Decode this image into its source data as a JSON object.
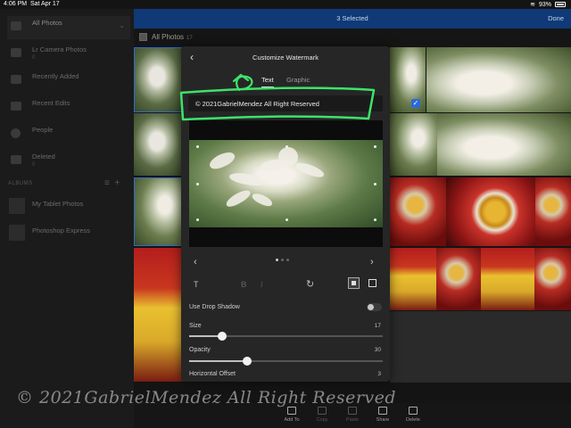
{
  "status": {
    "time": "4:06 PM",
    "date": "Sat Apr 17",
    "battery": "93%"
  },
  "sidebar": {
    "items": [
      {
        "label": "All Photos",
        "count": ""
      },
      {
        "label": "Lr Camera Photos",
        "count": "0"
      },
      {
        "label": "Recently Added",
        "count": ""
      },
      {
        "label": "Recent Edits",
        "count": ""
      },
      {
        "label": "People",
        "count": ""
      },
      {
        "label": "Deleted",
        "count": "0"
      }
    ],
    "albums_heading": "ALBUMS",
    "albums": [
      {
        "label": "My Tablet Photos",
        "count": ""
      },
      {
        "label": "Photoshop Express",
        "count": ""
      }
    ]
  },
  "selbar": {
    "title": "3 Selected",
    "done": "Done"
  },
  "grid": {
    "title": "All Photos",
    "count": "17"
  },
  "modal": {
    "title": "Customize Watermark",
    "tabs": [
      "Text",
      "Graphic"
    ],
    "active_tab": "Text",
    "watermark_text": "© 2021GabrielMendez All Right Reserved",
    "drop_shadow_label": "Use Drop Shadow",
    "drop_shadow_on": false,
    "sliders": [
      {
        "label": "Size",
        "value": "17",
        "fraction": 0.17
      },
      {
        "label": "Opacity",
        "value": "30",
        "fraction": 0.3
      }
    ],
    "horizontal_offset_label": "Horizontal Offset",
    "horizontal_offset_value": "3"
  },
  "overlay_watermark": "© 2021GabrielMendez All Right Reserved",
  "bottombar": {
    "buttons": [
      {
        "label": "Add To",
        "enabled": true
      },
      {
        "label": "Copy",
        "enabled": false
      },
      {
        "label": "Paste",
        "enabled": false
      },
      {
        "label": "Share",
        "enabled": true
      },
      {
        "label": "Delete",
        "enabled": true
      }
    ]
  },
  "colors": {
    "selection_bar": "#0f3a77",
    "accent": "#2b6bd6",
    "annotation": "#3ee36a"
  }
}
